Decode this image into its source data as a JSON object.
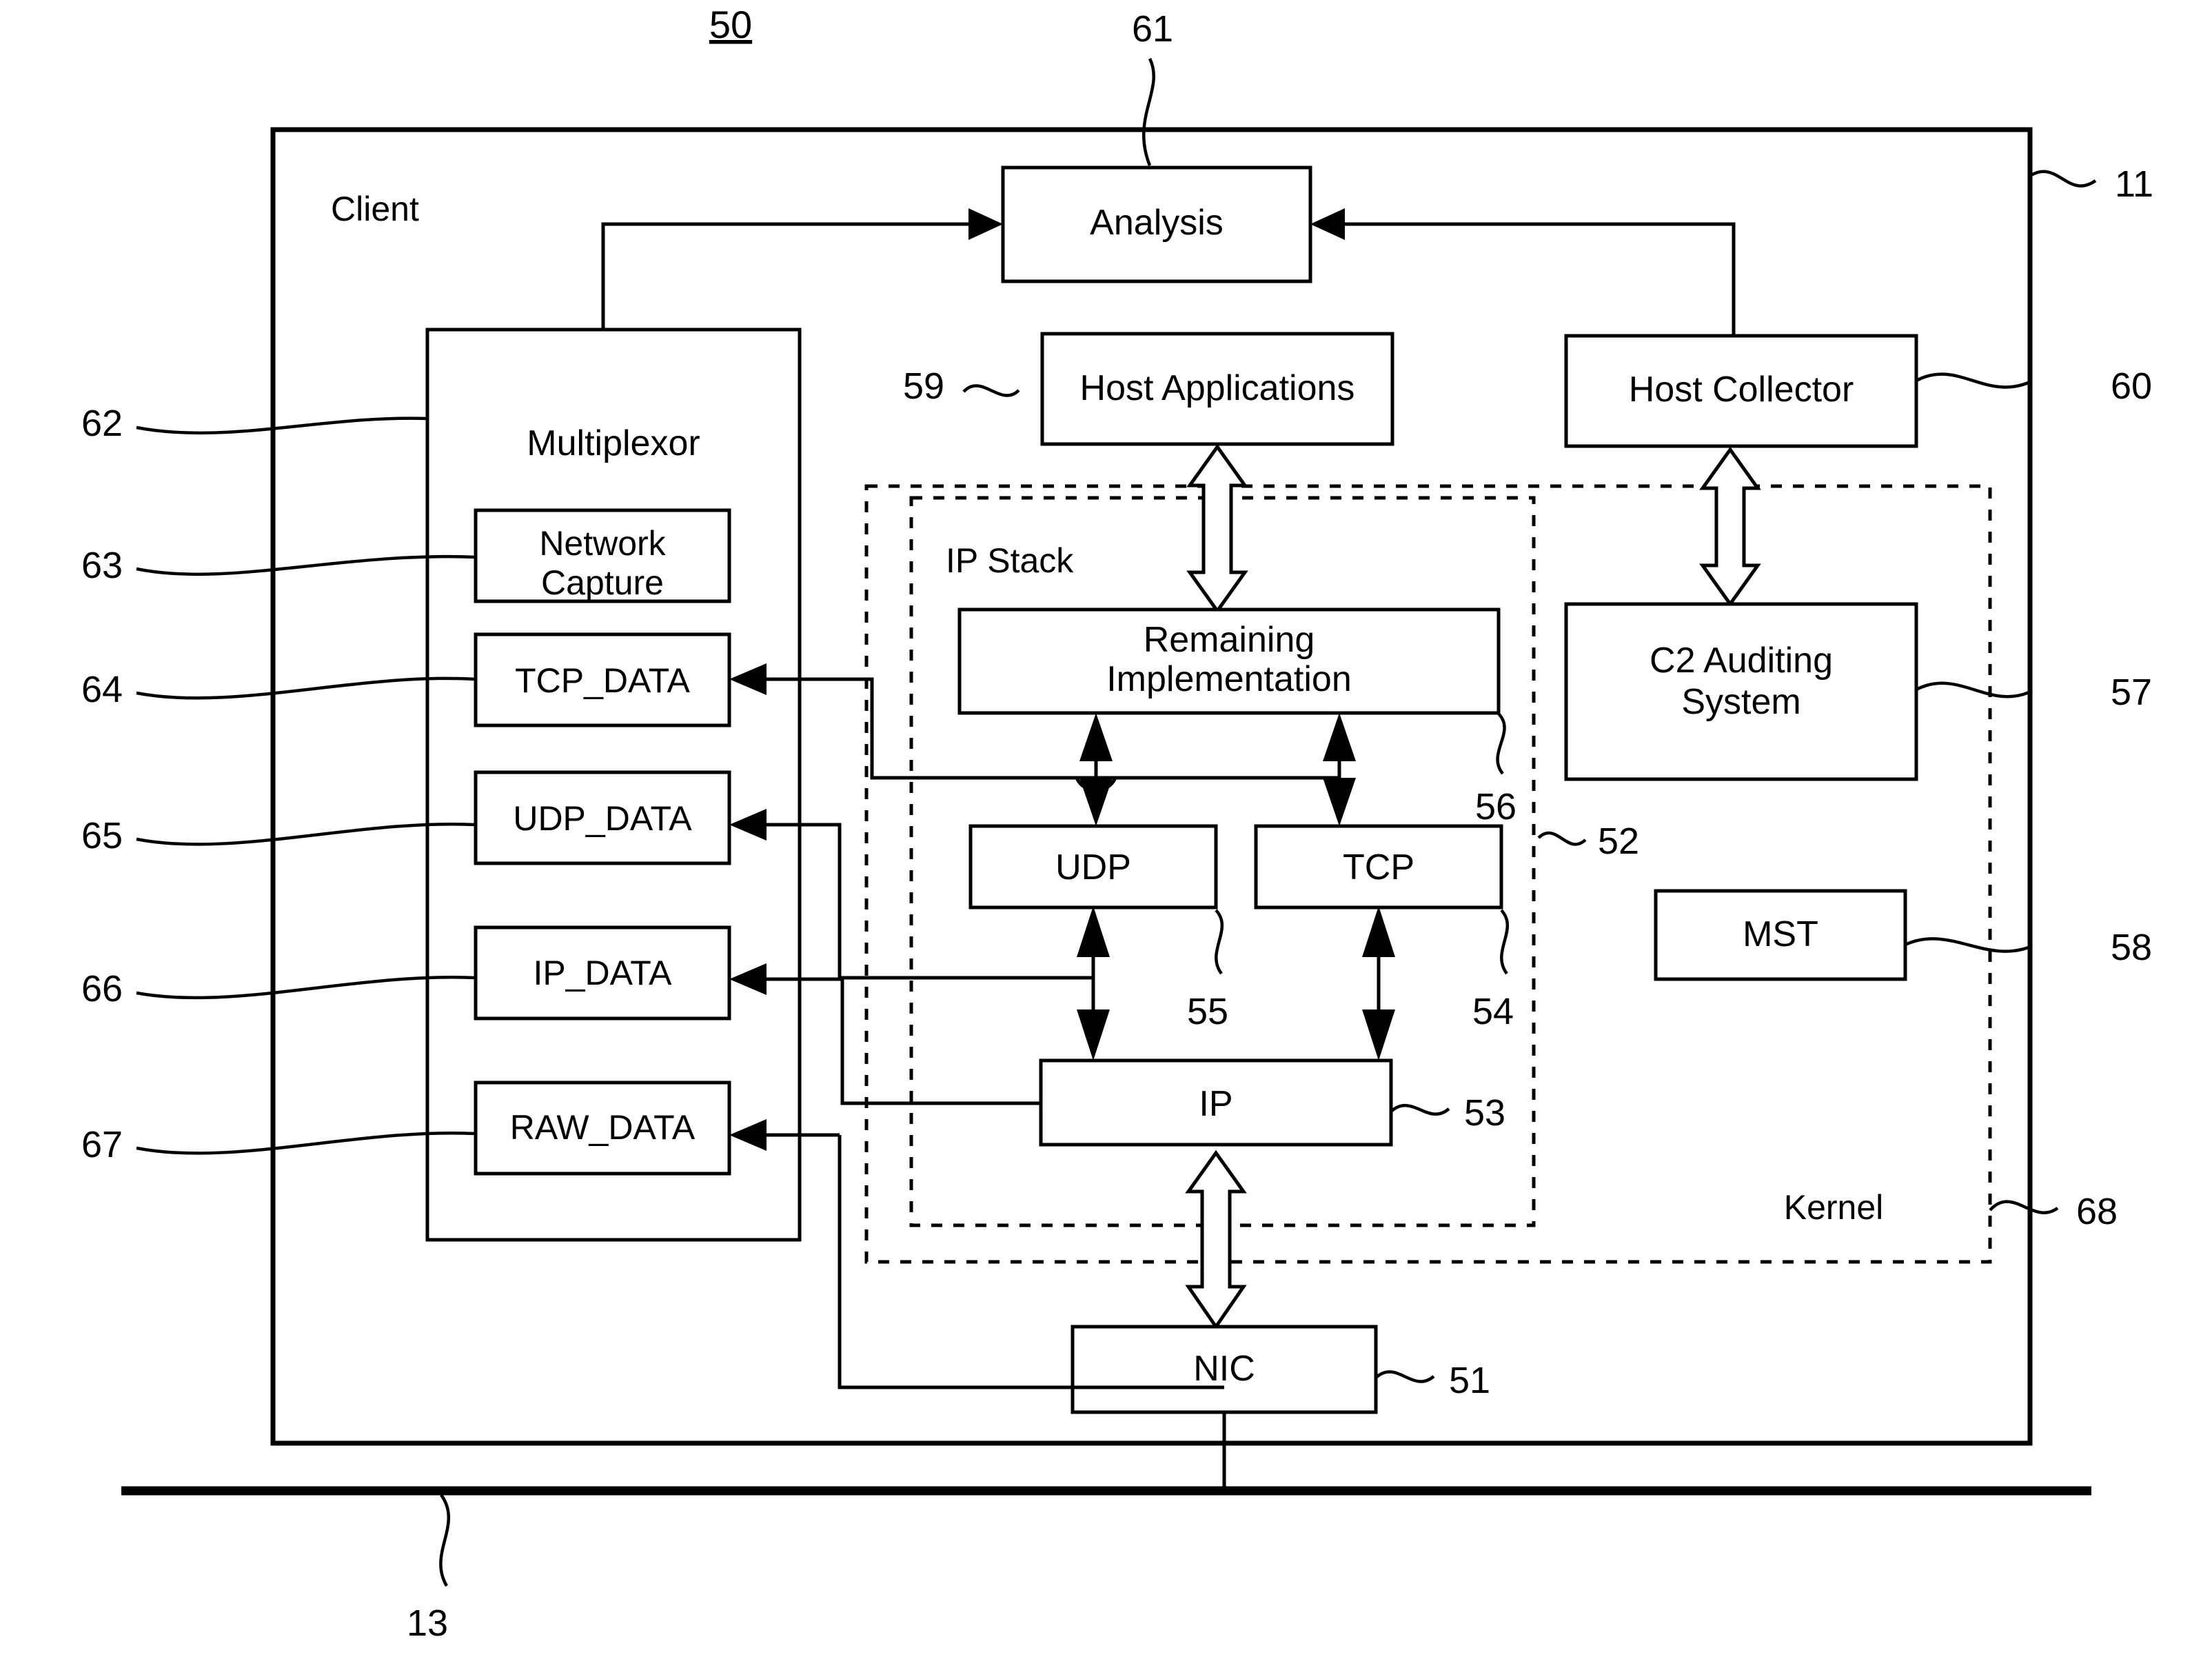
{
  "figure": {
    "number": "50",
    "outer_container_label": "Client",
    "kernel_label": "Kernel"
  },
  "references": {
    "fig": "50",
    "analysis": "61",
    "client": "11",
    "multiplexor": "62",
    "network_capture": "63",
    "tcp_data": "64",
    "udp_data": "65",
    "ip_data": "66",
    "raw_data": "67",
    "host_applications": "59",
    "host_collector": "60",
    "c2_auditing": "57",
    "mst": "58",
    "remaining_implementation": "56",
    "ip_stack": "52",
    "udp": "55",
    "tcp": "54",
    "ip": "53",
    "nic": "51",
    "kernel": "68",
    "network_bus": "13"
  },
  "blocks": {
    "analysis": "Analysis",
    "multiplexor": "Multiplexor",
    "network_capture_line1": "Network",
    "network_capture_line2": "Capture",
    "tcp_data": "TCP_DATA",
    "udp_data": "UDP_DATA",
    "ip_data": "IP_DATA",
    "raw_data": "RAW_DATA",
    "host_applications": "Host Applications",
    "host_collector": "Host Collector",
    "ip_stack": "IP Stack",
    "remaining_impl_line1": "Remaining",
    "remaining_impl_line2": "Implementation",
    "udp": "UDP",
    "tcp": "TCP",
    "ip": "IP",
    "c2_auditing_line1": "C2 Auditing",
    "c2_auditing_line2": "System",
    "mst": "MST",
    "nic": "NIC"
  },
  "colors": {
    "ink": "#000000",
    "paper": "#ffffff"
  }
}
